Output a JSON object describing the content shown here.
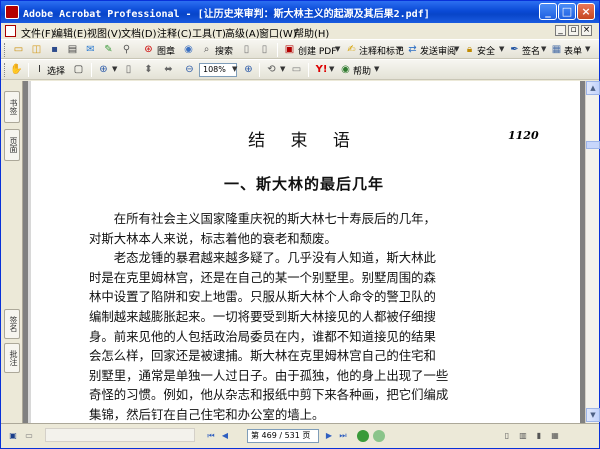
{
  "window": {
    "title": "Adobe Acrobat Professional - [让历史来审判：斯大林主义的起源及其后果2.pdf]",
    "controls": {
      "minimize": "_",
      "maximize": "□",
      "close": "×"
    }
  },
  "menu": {
    "items": [
      "文件(F)",
      "编辑(E)",
      "视图(V)",
      "文档(D)",
      "注释(C)",
      "工具(T)",
      "高级(A)",
      "窗口(W)",
      "帮助(H)"
    ],
    "doc_controls": {
      "minimize": "_",
      "restore": "▫",
      "close": "×"
    }
  },
  "toolbar1": {
    "search_label": "搜索",
    "create_pdf_label": "创建 PDF",
    "comment_label": "注释和标记",
    "send_review_label": "发送审阅",
    "security_label": "安全",
    "sign_label": "签名",
    "forms_label": "表单",
    "photo_label": "图章"
  },
  "toolbar2": {
    "select_label": "选择",
    "zoom_value": "108%",
    "help_label": "帮助"
  },
  "nav_tabs": [
    "书签",
    "页面",
    "签名",
    "批注"
  ],
  "document": {
    "page_number_mark": "1120",
    "heading": "结 束 语",
    "section_title": "一、斯大林的最后几年",
    "lines": [
      "　　在所有社会主义国家隆重庆祝的斯大林七十寿辰后的几年，",
      "对斯大林本人来说，标志着他的衰老和颓废。",
      "　　老态龙锺的暴君越来越多疑了。几乎没有人知道，斯大林此",
      "时是在克里姆林宫，还是在自己的某一个别墅里。别墅周围的森",
      "林中设置了陷阱和安上地雷。只服从斯大林个人命令的警卫队的",
      "编制越来越膨胀起来。一切将要受到斯大林接见的人都被仔细搜",
      "身。前来见他的人包括政治局委员在内，谁都不知道接见的结果",
      "会怎么样，回家还是被逮捕。斯大林在克里姆林宫自己的住宅和",
      "别墅里，通常是单独一人过日子。由于孤独，他的身上出现了一些",
      "奇怪的习惯。例如，他从杂志和报纸中剪下来各种画，把它们编成",
      "集锦，然后钉在自己住宅和办公室的墙上。"
    ]
  },
  "status": {
    "page_indicator": "第 469 / 531 页"
  },
  "colors": {
    "titlebar": "#0a4ad6",
    "chrome": "#ece9d8",
    "workspace": "#808080",
    "page": "#ffffff"
  }
}
